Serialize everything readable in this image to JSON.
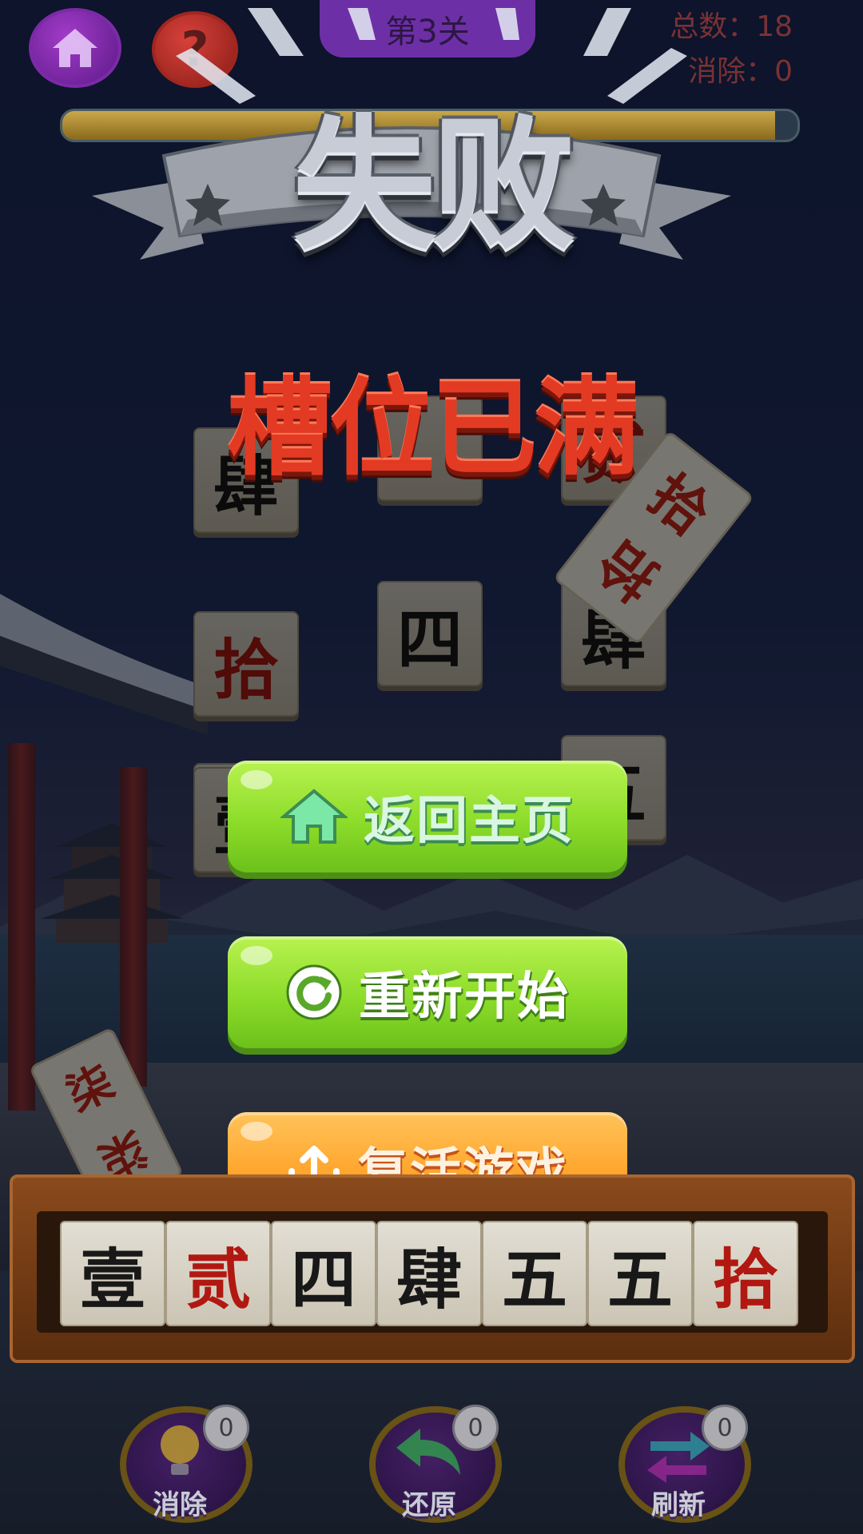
{
  "header": {
    "level": "第3关",
    "total_label": "总数：18",
    "cleared_label": "消除：0",
    "progress": 0.97,
    "help_symbol": "?"
  },
  "dialog": {
    "title": "失败",
    "reason": "槽位已满",
    "buttons": {
      "home": {
        "label": "返回主页",
        "icon": "home-icon"
      },
      "restart": {
        "label": "重新开始",
        "icon": "refresh-icon"
      },
      "revive": {
        "label": "复活游戏",
        "icon": "upload-icon",
        "badge_icon": "video-icon"
      }
    }
  },
  "board": {
    "tiles": [
      {
        "char": "肆",
        "color": "black"
      },
      {
        "char": "",
        "color": "black"
      },
      {
        "char": "贰",
        "color": "red"
      },
      {
        "char": "拾",
        "color": "red"
      },
      {
        "char": "四",
        "color": "black"
      },
      {
        "char": "肆",
        "color": "black"
      },
      {
        "char": "柒",
        "color": "red"
      },
      {
        "char": "壹",
        "color": "black"
      },
      {
        "char": "五",
        "color": "black"
      }
    ],
    "floating_cards": [
      {
        "chars": [
          "拾",
          "拾"
        ]
      },
      {
        "chars": [
          "柒",
          "柒"
        ]
      }
    ]
  },
  "slot_tray": {
    "tiles": [
      {
        "char": "壹",
        "color": "black"
      },
      {
        "char": "贰",
        "color": "red"
      },
      {
        "char": "四",
        "color": "black"
      },
      {
        "char": "肆",
        "color": "black"
      },
      {
        "char": "五",
        "color": "black"
      },
      {
        "char": "五",
        "color": "black"
      },
      {
        "char": "拾",
        "color": "red"
      }
    ]
  },
  "tools": [
    {
      "label": "消除",
      "count": "0",
      "icon": "lightbulb-icon"
    },
    {
      "label": "还原",
      "count": "0",
      "icon": "undo-arrow-icon"
    },
    {
      "label": "刷新",
      "count": "0",
      "icon": "shuffle-icon"
    }
  ],
  "colors": {
    "green_button": "#8ddc2a",
    "orange_button": "#ffa52c",
    "fail_red": "#e33a23",
    "tile_red": "#c01a12"
  }
}
